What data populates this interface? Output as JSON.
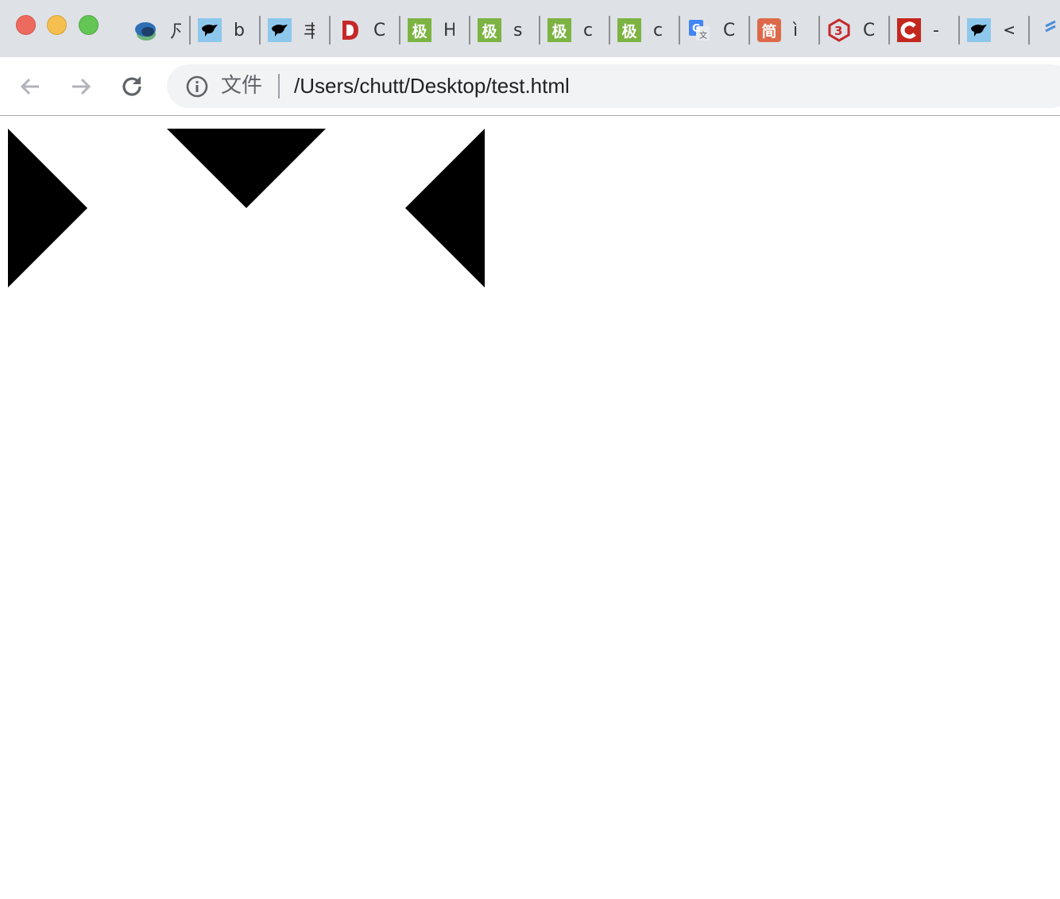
{
  "window": {
    "controls": [
      "close",
      "minimize",
      "maximize"
    ]
  },
  "tabs": [
    {
      "icon": "layers-logo-icon",
      "text": "凡"
    },
    {
      "icon": "eagle-logo-icon",
      "text": "b"
    },
    {
      "icon": "eagle-logo-icon",
      "text": "丰"
    },
    {
      "icon": "red-d-logo-icon",
      "text": "C"
    },
    {
      "icon": "green-template-icon",
      "glyph": "极",
      "text": "H"
    },
    {
      "icon": "green-template-icon",
      "glyph": "极",
      "text": "s"
    },
    {
      "icon": "green-template-icon",
      "glyph": "极",
      "text": "c"
    },
    {
      "icon": "green-template-icon",
      "glyph": "极",
      "text": "c"
    },
    {
      "icon": "google-translate-icon",
      "text": "C"
    },
    {
      "icon": "jianshu-icon",
      "glyph": "简",
      "text": "ì"
    },
    {
      "icon": "red-3-logo-icon",
      "text": "C"
    },
    {
      "icon": "red-c-logo-icon",
      "text": "-"
    },
    {
      "icon": "eagle-logo-icon",
      "text": "<"
    }
  ],
  "toolbar": {
    "scheme_label": "文件",
    "url": "/Users/chutt/Desktop/test.html"
  },
  "page": {
    "shapes": [
      {
        "name": "triangle-right",
        "color": "#000000"
      },
      {
        "name": "triangle-down",
        "color": "#000000"
      },
      {
        "name": "triangle-left",
        "color": "#000000"
      }
    ]
  }
}
